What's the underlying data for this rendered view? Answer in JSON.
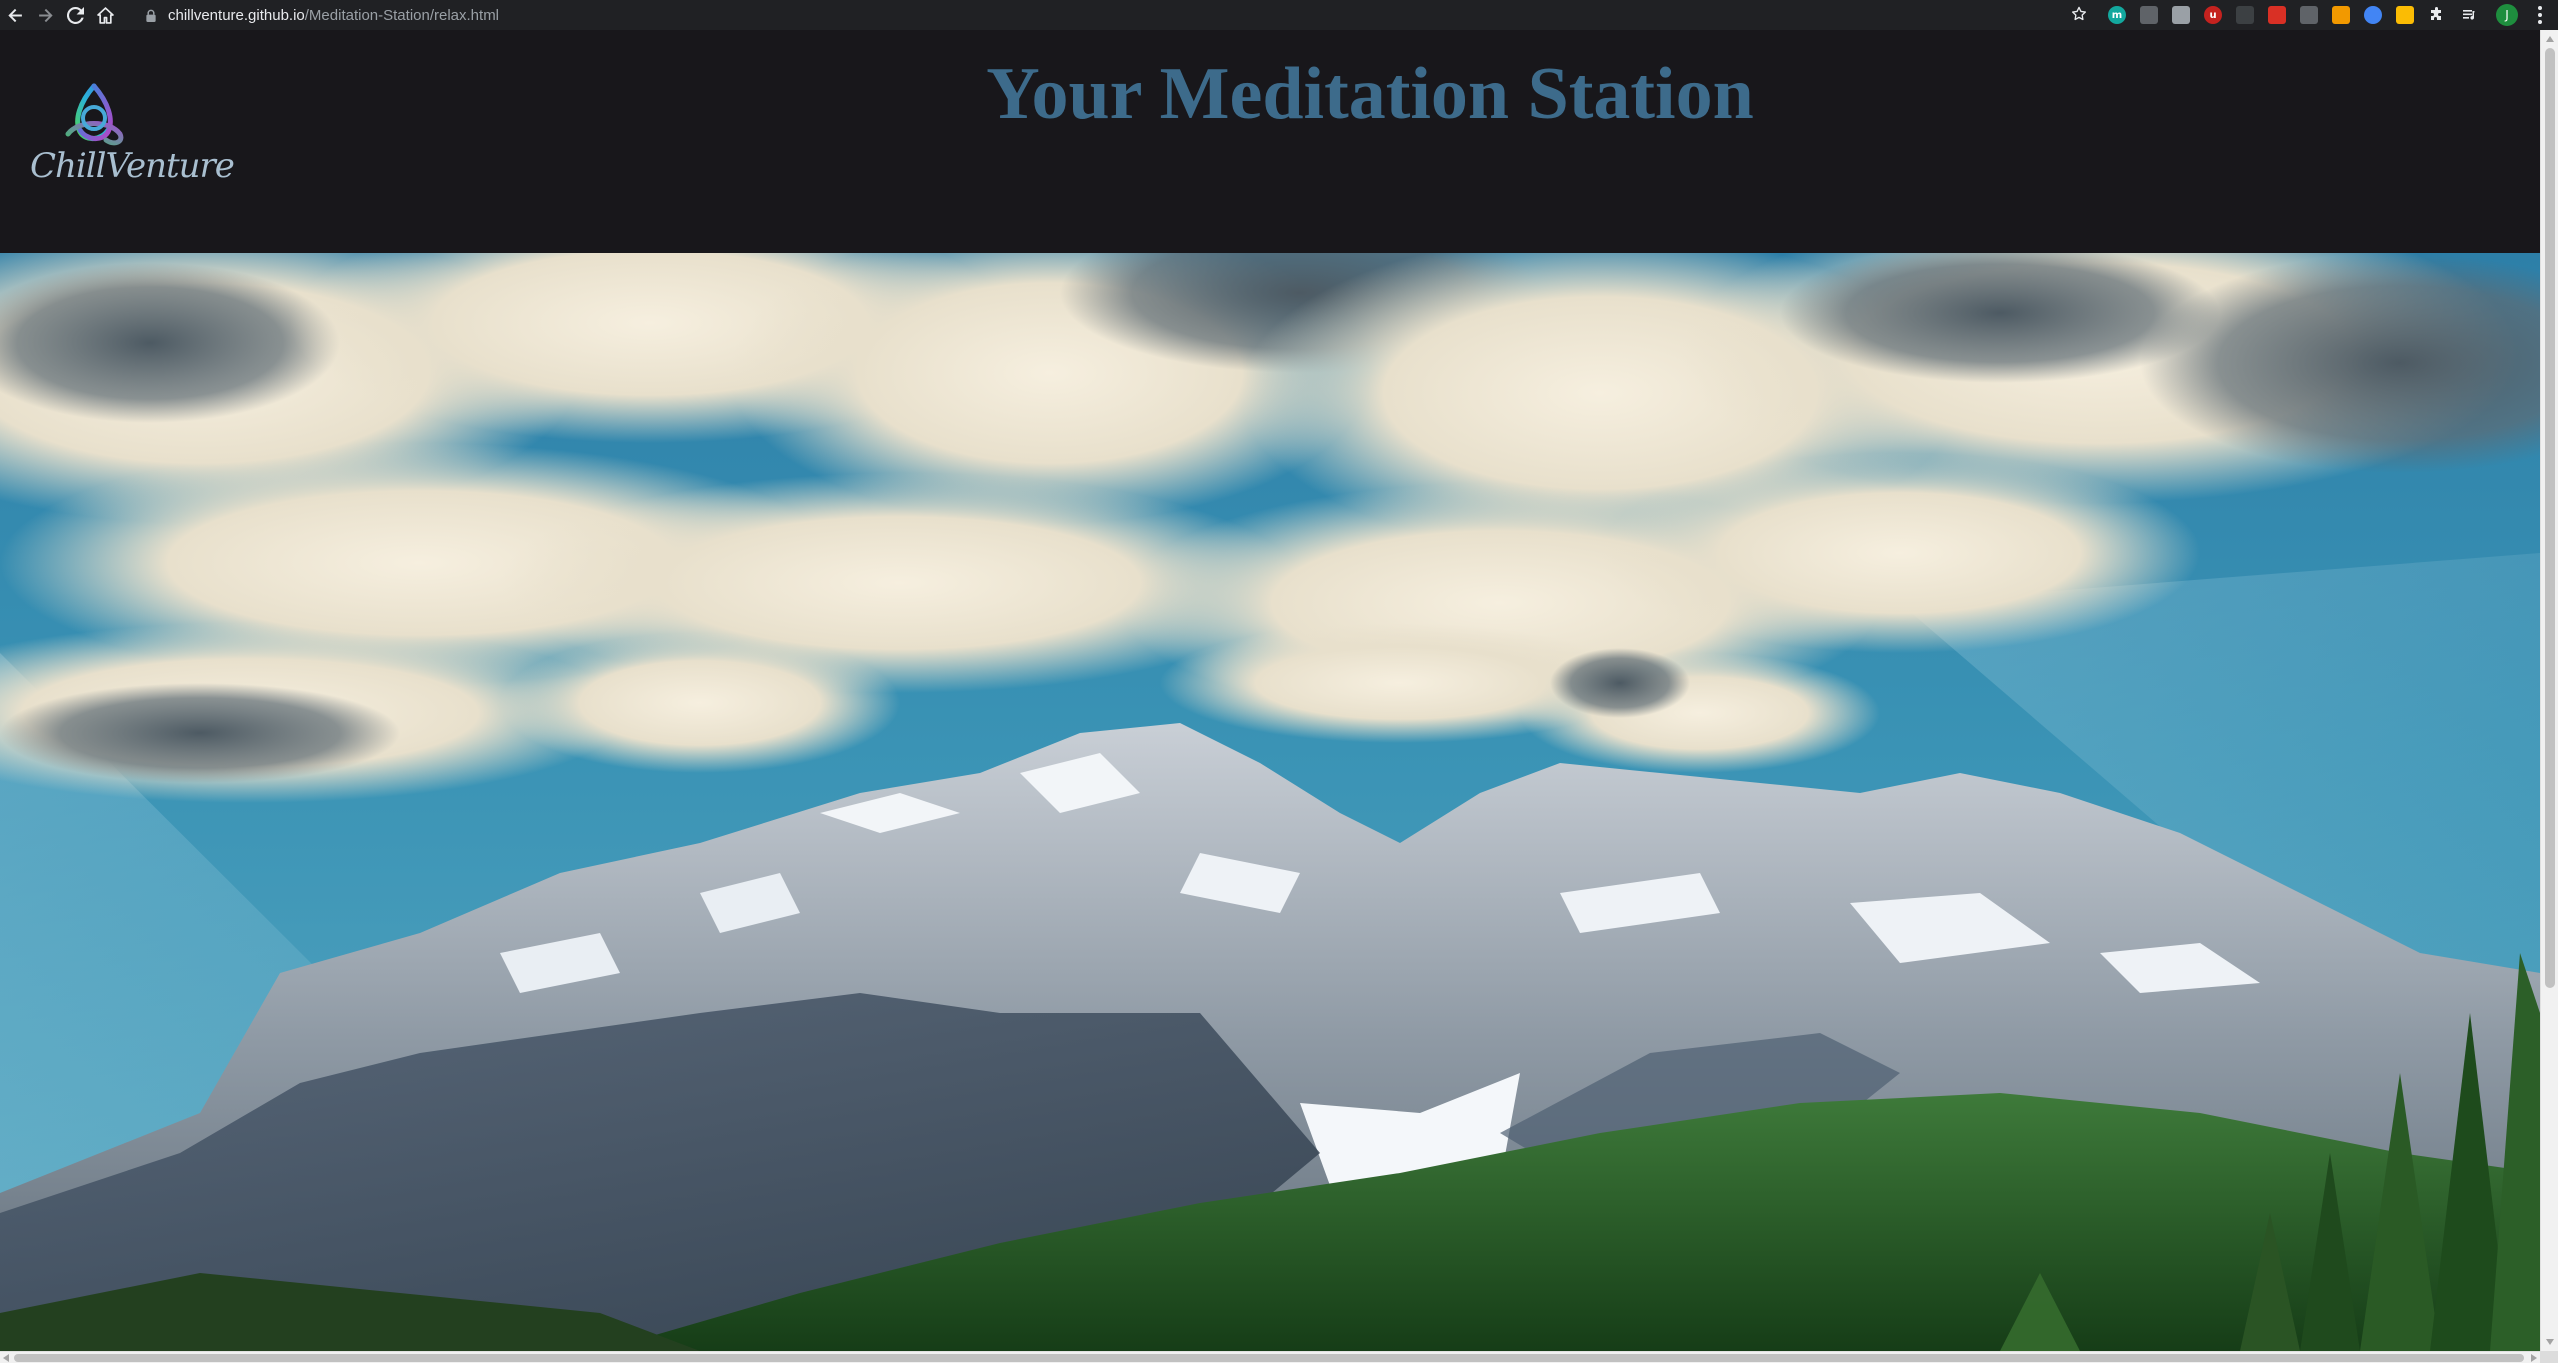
{
  "browser": {
    "url_host": "chillventure.github.io",
    "url_path": "/Meditation-Station/relax.html",
    "profile_initial": "J",
    "extensions": [
      {
        "name": "m-extension-icon",
        "color": "#13a89e",
        "glyph": "m",
        "round": true
      },
      {
        "name": "screen-extension-icon",
        "color": "#5f6368",
        "glyph": "",
        "round": false
      },
      {
        "name": "doc-extension-icon",
        "color": "#9aa0a6",
        "glyph": "",
        "round": false
      },
      {
        "name": "ublock-extension-icon",
        "color": "#c5221f",
        "glyph": "u",
        "round": true
      },
      {
        "name": "video-extension-icon",
        "color": "#3c4043",
        "glyph": "",
        "round": false
      },
      {
        "name": "bookmark-extension-icon",
        "color": "#d93025",
        "glyph": "",
        "round": false
      },
      {
        "name": "rocket-extension-icon",
        "color": "#5f6368",
        "glyph": "",
        "round": false
      },
      {
        "name": "diamond-extension-icon",
        "color": "#f29900",
        "glyph": "",
        "round": false
      },
      {
        "name": "snowflake-extension-icon",
        "color": "#4285f4",
        "glyph": "",
        "round": true
      },
      {
        "name": "palette-extension-icon",
        "color": "#fbbc04",
        "glyph": "",
        "round": false
      }
    ]
  },
  "site": {
    "logo_text": "ChillVenture",
    "title": "Your Meditation Station",
    "colors": {
      "header_bg": "#18171b",
      "title": "#3d6b8b"
    }
  }
}
